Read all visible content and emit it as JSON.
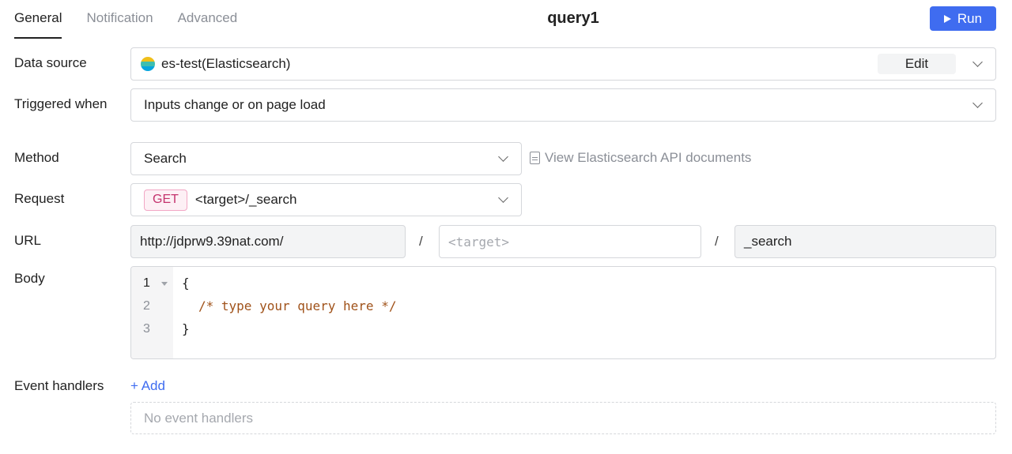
{
  "tabs": [
    {
      "label": "General"
    },
    {
      "label": "Notification"
    },
    {
      "label": "Advanced"
    }
  ],
  "query_name": "query1",
  "run_button": {
    "label": "Run",
    "color": "#3f6cf0"
  },
  "data_source": {
    "label": "Data source",
    "value": "es-test(Elasticsearch)",
    "edit_label": "Edit",
    "icon": "elasticsearch-logo"
  },
  "triggered_when": {
    "label": "Triggered when",
    "value": "Inputs change or on page load"
  },
  "method": {
    "label": "Method",
    "value": "Search",
    "doc_link": "View Elasticsearch API documents"
  },
  "request": {
    "label": "Request",
    "verb": "GET",
    "path": "<target>/_search"
  },
  "url": {
    "label": "URL",
    "base": "http://jdprw9.39nat.com/",
    "separator": "/",
    "target_placeholder": "<target>",
    "suffix": "_search"
  },
  "body": {
    "label": "Body",
    "line_numbers": [
      "1",
      "2",
      "3"
    ],
    "lines": [
      "{",
      "/* type your query here */",
      "}"
    ]
  },
  "event_handlers": {
    "label": "Event handlers",
    "add_label": "+ Add",
    "empty_text": "No event handlers"
  }
}
